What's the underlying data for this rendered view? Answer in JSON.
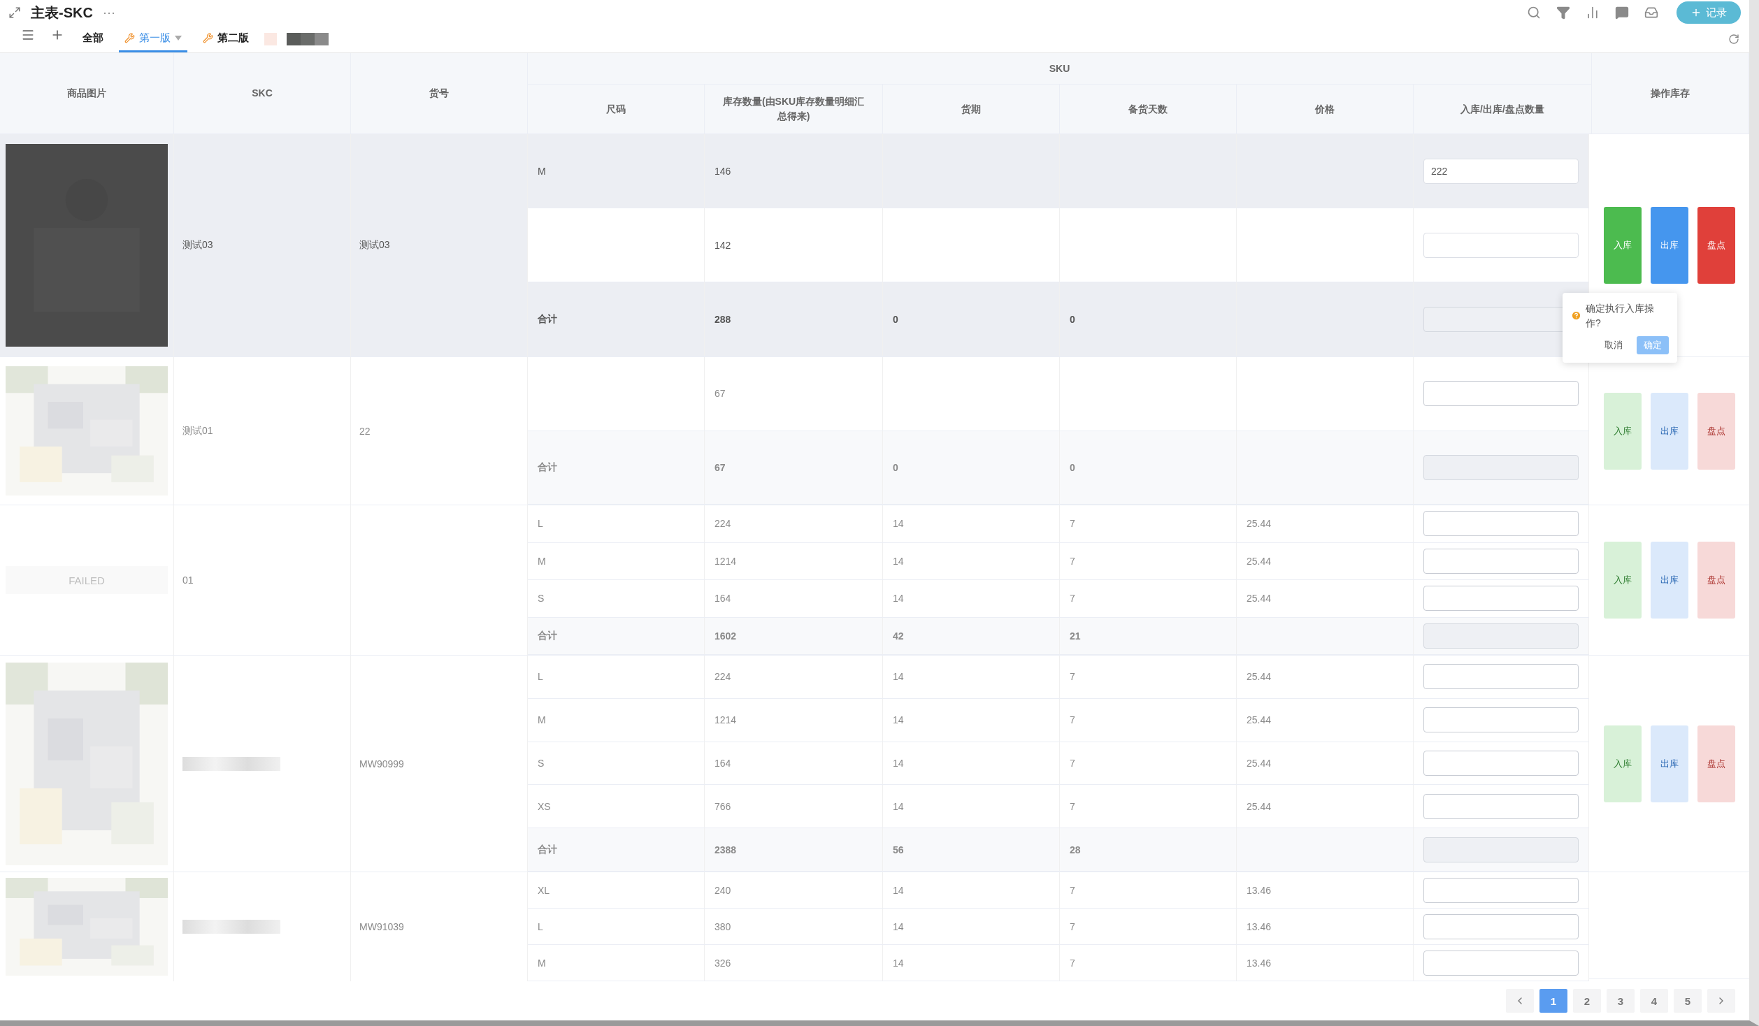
{
  "title": "主表-SKC",
  "more": "···",
  "views": [
    {
      "label": "全部",
      "kind": "plain",
      "selected": false
    },
    {
      "label": "第一版",
      "kind": "tool",
      "selected": true
    },
    {
      "label": "第二版",
      "kind": "tool",
      "selected": false
    }
  ],
  "add_record": "记录",
  "columns": {
    "image": "商品图片",
    "skc": "SKC",
    "code": "货号",
    "sku": "SKU",
    "size": "尺码",
    "stock": "库存数量(由SKU库存数量明细汇总得来)",
    "lead": "货期",
    "prep": "备货天数",
    "price": "价格",
    "qty": "入库/出库/盘点数量",
    "ops": "操作库存"
  },
  "groups": [
    {
      "image": {
        "kind": "picture"
      },
      "skc": "测试03",
      "code": "测试03",
      "highlighted": true,
      "dimmed": false,
      "actions": [
        "入库",
        "出库",
        "盘点"
      ],
      "rows": [
        {
          "kind": "sku",
          "size": "M",
          "stock": "146",
          "qty": "222"
        },
        {
          "kind": "sku",
          "stock": "142"
        },
        {
          "kind": "total",
          "size": "合计",
          "stock": "288",
          "lead": "0",
          "prep": "0"
        }
      ]
    },
    {
      "image": {
        "kind": "picture"
      },
      "skc": "测试01",
      "code": "22",
      "highlighted": false,
      "dimmed": true,
      "actions": [
        "入库",
        "出库",
        "盘点"
      ],
      "rows": [
        {
          "kind": "sku",
          "stock": "67"
        },
        {
          "kind": "total",
          "size": "合计",
          "stock": "67",
          "lead": "0",
          "prep": "0"
        }
      ]
    },
    {
      "image": {
        "kind": "failed",
        "text": "FAILED"
      },
      "skc": "01",
      "highlighted": false,
      "dimmed": true,
      "actions": [
        "入库",
        "出库",
        "盘点"
      ],
      "rows": [
        {
          "kind": "sku",
          "size": "L",
          "stock": "224",
          "lead": "14",
          "prep": "7",
          "price": "25.44"
        },
        {
          "kind": "sku",
          "size": "M",
          "stock": "1214",
          "lead": "14",
          "prep": "7",
          "price": "25.44"
        },
        {
          "kind": "sku",
          "size": "S",
          "stock": "164",
          "lead": "14",
          "prep": "7",
          "price": "25.44"
        },
        {
          "kind": "total",
          "size": "合计",
          "stock": "1602",
          "lead": "42",
          "prep": "21"
        }
      ]
    },
    {
      "image": {
        "kind": "picture"
      },
      "skc_redacted": true,
      "code": "MW90999",
      "highlighted": false,
      "dimmed": true,
      "actions": [
        "入库",
        "出库",
        "盘点"
      ],
      "rows": [
        {
          "kind": "sku",
          "size": "L",
          "stock": "224",
          "lead": "14",
          "prep": "7",
          "price": "25.44"
        },
        {
          "kind": "sku",
          "size": "M",
          "stock": "1214",
          "lead": "14",
          "prep": "7",
          "price": "25.44"
        },
        {
          "kind": "sku",
          "size": "S",
          "stock": "164",
          "lead": "14",
          "prep": "7",
          "price": "25.44"
        },
        {
          "kind": "sku",
          "size": "XS",
          "stock": "766",
          "lead": "14",
          "prep": "7",
          "price": "25.44"
        },
        {
          "kind": "total",
          "size": "合计",
          "stock": "2388",
          "lead": "56",
          "prep": "28"
        }
      ]
    },
    {
      "image": {
        "kind": "picture"
      },
      "skc_redacted": true,
      "code": "MW91039",
      "highlighted": false,
      "dimmed": true,
      "rows": [
        {
          "kind": "sku",
          "size": "XL",
          "stock": "240",
          "lead": "14",
          "prep": "7",
          "price": "13.46"
        },
        {
          "kind": "sku",
          "size": "L",
          "stock": "380",
          "lead": "14",
          "prep": "7",
          "price": "13.46"
        },
        {
          "kind": "sku",
          "size": "M",
          "stock": "326",
          "lead": "14",
          "prep": "7",
          "price": "13.46"
        }
      ]
    }
  ],
  "popconfirm": {
    "message": "确定执行入库操作?",
    "cancel": "取消",
    "confirm": "确定"
  },
  "pagination": {
    "pages": [
      {
        "label": "1",
        "selected": true
      },
      {
        "label": "2",
        "selected": false
      },
      {
        "label": "3",
        "selected": false
      },
      {
        "label": "4",
        "selected": false
      },
      {
        "label": "5",
        "selected": false
      }
    ]
  }
}
